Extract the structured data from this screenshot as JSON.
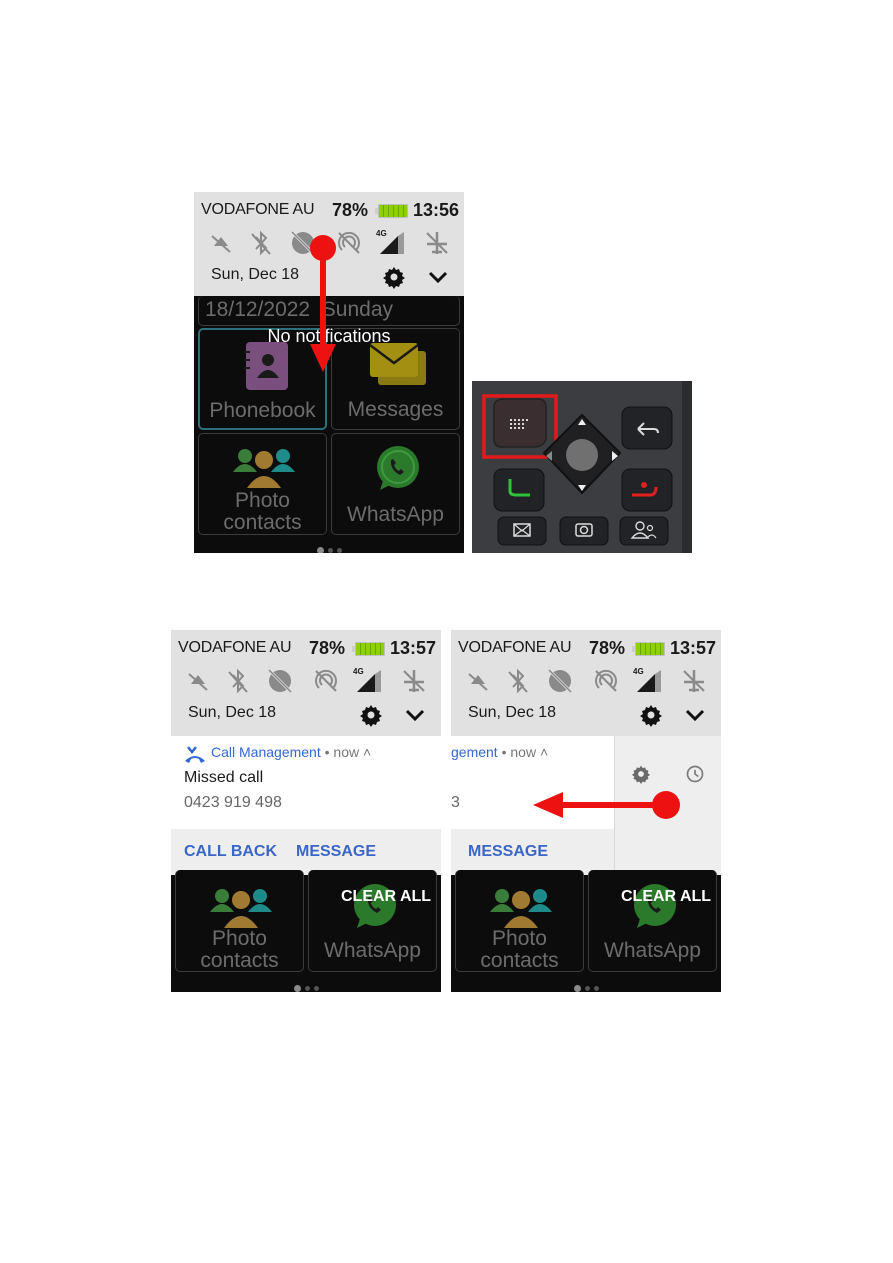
{
  "figure_top": {
    "status": {
      "carrier": "VODAFONE AU",
      "battery_pct": "78%",
      "time": "13:56",
      "battery_level": 0.78
    },
    "quick_settings": [
      "silent-off-icon",
      "bluetooth-off-icon",
      "data-saver-off-icon",
      "hotspot-off-icon",
      "mobile-signal-4g-icon",
      "airplane-off-icon"
    ],
    "signal_label": "4G",
    "date": "Sun, Dec 18",
    "home": {
      "date_banner": "18/12/2022  Sunday",
      "no_notifications": "No notifications",
      "tiles": [
        {
          "label": "Phonebook"
        },
        {
          "label": "Messages"
        },
        {
          "label_line1": "Photo",
          "label_line2": "contacts"
        },
        {
          "label": "WhatsApp"
        }
      ]
    },
    "annotation": "swipe-down-arrow"
  },
  "keypad": {
    "highlighted_key": "menu-key",
    "keys": [
      "menu-key",
      "navigation-pad",
      "back-key",
      "call-key",
      "end-call-key",
      "message-key",
      "camera-key",
      "contacts-key"
    ],
    "colors": {
      "highlight": "#e3191c",
      "call": "#2fc23a",
      "end": "#e02020"
    }
  },
  "figure_bottom_left": {
    "status": {
      "carrier": "VODAFONE AU",
      "battery_pct": "78%",
      "time": "13:57"
    },
    "signal_label": "4G",
    "date": "Sun, Dec 18",
    "notification": {
      "app": "Call Management",
      "when": "• now",
      "title": "Missed call",
      "body": "0423 919 498",
      "actions": [
        "CALL BACK",
        "MESSAGE"
      ]
    },
    "clear_all": "CLEAR ALL",
    "tiles": [
      {
        "label_line1": "Photo",
        "label_line2": "contacts"
      },
      {
        "label": "WhatsApp"
      }
    ]
  },
  "figure_bottom_right": {
    "status": {
      "carrier": "VODAFONE AU",
      "battery_pct": "78%",
      "time": "13:57"
    },
    "signal_label": "4G",
    "date": "Sun, Dec 18",
    "notification": {
      "app_partial": "gement",
      "when": "• now",
      "body_partial": "3",
      "actions": [
        "MESSAGE"
      ]
    },
    "swipe_panel_icons": [
      "settings-icon",
      "snooze-clock-icon"
    ],
    "clear_all": "CLEAR ALL",
    "tiles": [
      {
        "label_line1": "Photo",
        "label_line2": "contacts"
      },
      {
        "label": "WhatsApp"
      }
    ],
    "annotation": "swipe-left-arrow"
  },
  "colors": {
    "arrow_red": "#ee1111",
    "link_blue": "#3a66c8",
    "shade_bg": "#e1e1e1"
  }
}
